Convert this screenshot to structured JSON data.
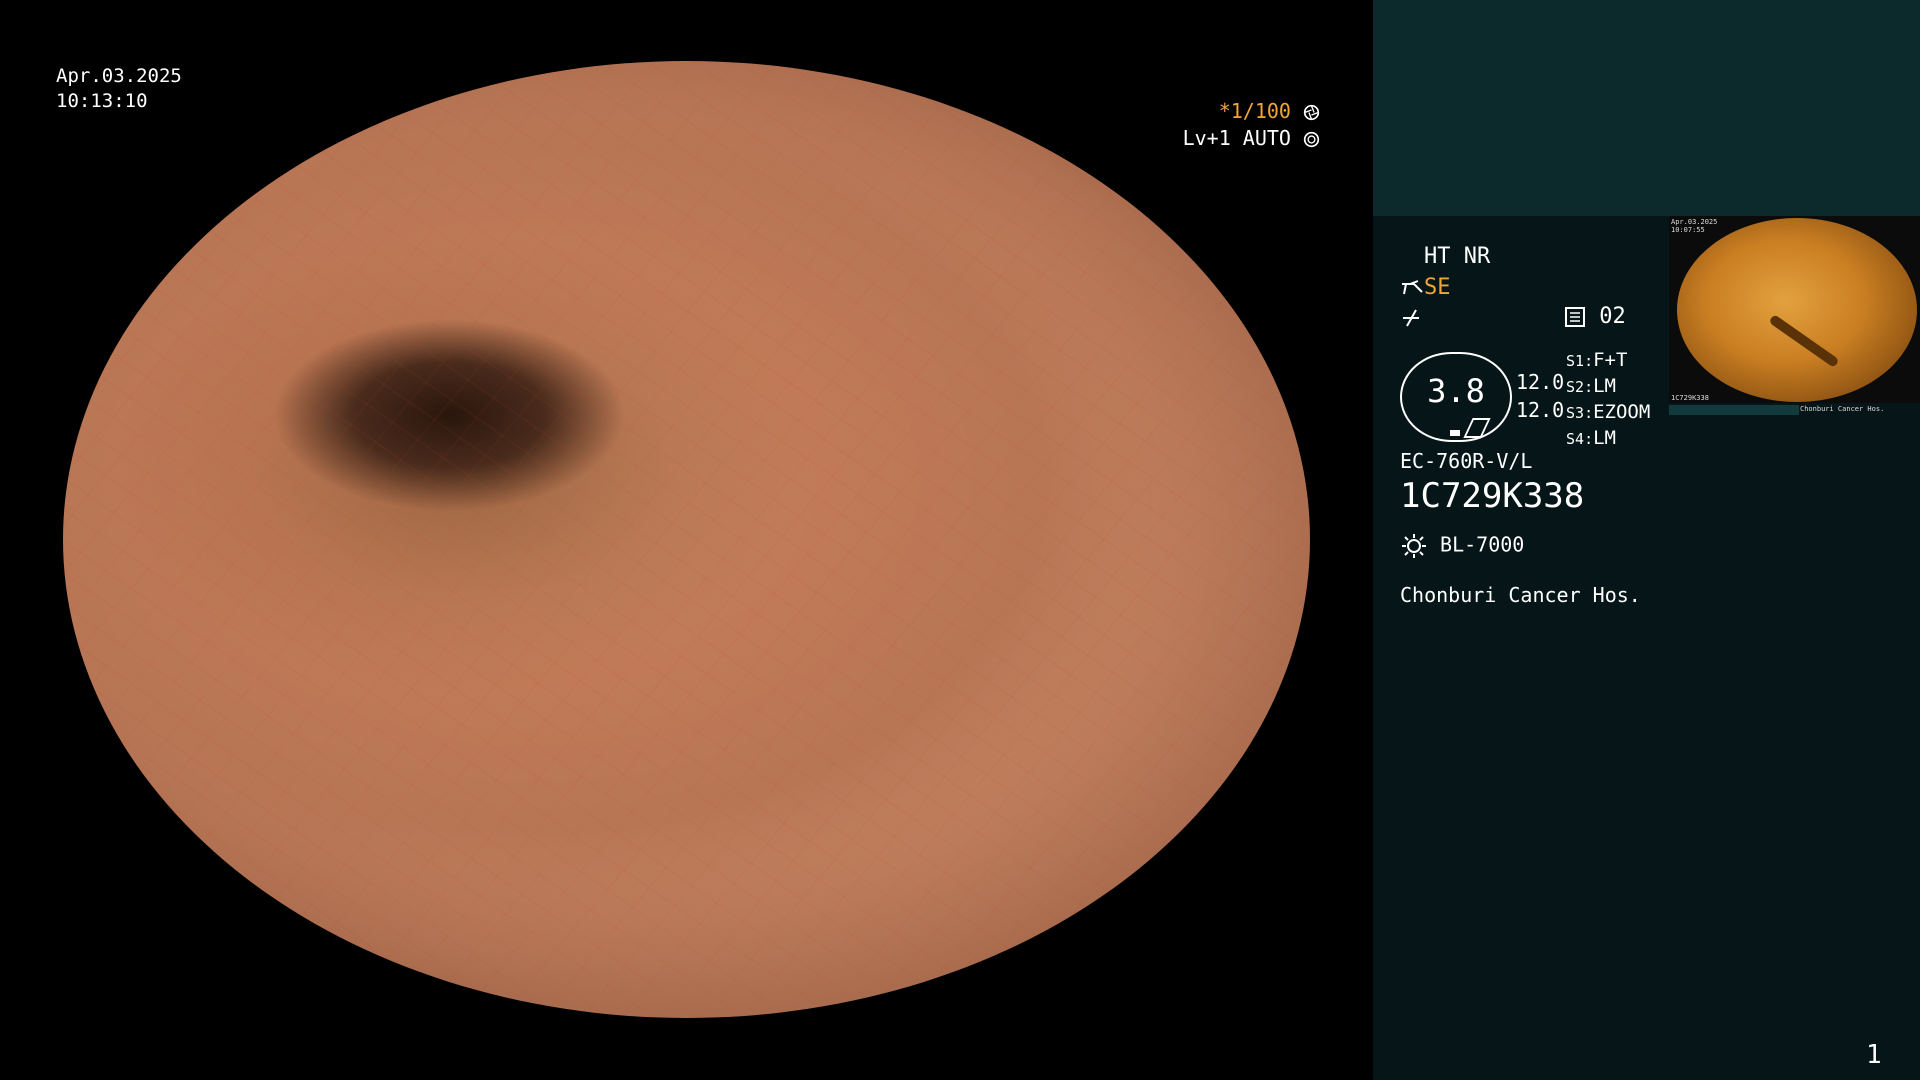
{
  "overlay": {
    "date": "Apr.03.2025",
    "time": "10:13:10",
    "shutter": "*1/100",
    "level": "Lv+1 AUTO"
  },
  "panel": {
    "mode": "HT NR",
    "enhance": "SE",
    "memory_slot": "02",
    "ring_value": "3.8",
    "ring_upper": "12.0",
    "ring_lower": "12.0",
    "switches": [
      {
        "key": "S1",
        "value": "F+T"
      },
      {
        "key": "S2",
        "value": "LM"
      },
      {
        "key": "S3",
        "value": "EZOOM"
      },
      {
        "key": "S4",
        "value": "LM"
      }
    ],
    "scope_model": "EC-760R-V/L",
    "serial": "1C729K338",
    "light_source": "BL-7000",
    "hospital": "Chonburi Cancer Hos.",
    "page_number": "1"
  },
  "thumbnail": {
    "date": "Apr.03.2025",
    "time": "10:07:55",
    "serial": "1C729K338",
    "hospital": "Chonburi Cancer Hos."
  },
  "colors": {
    "accent": "#f0a53a",
    "panel_top": "#0c2a2b",
    "panel_bg": "#061517"
  },
  "icons": [
    "aperture-icon",
    "iris-icon",
    "scope-enhance-icon",
    "lightning-icon",
    "memory-icon",
    "light-source-icon"
  ]
}
